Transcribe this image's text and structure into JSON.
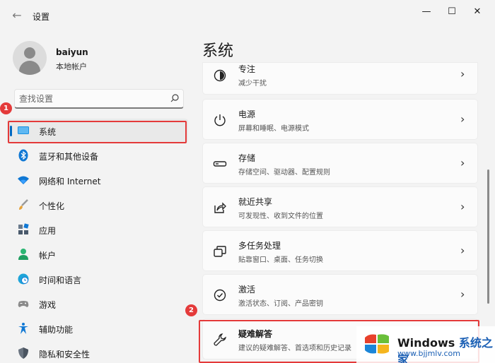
{
  "window": {
    "app_title": "设置",
    "back_glyph": "←",
    "minimize_glyph": "—",
    "maximize_glyph": "☐",
    "close_glyph": "✕"
  },
  "profile": {
    "name": "baiyun",
    "account_type": "本地帐户"
  },
  "search": {
    "placeholder": "查找设置"
  },
  "sidebar": {
    "items": [
      {
        "label": "系统",
        "icon": "monitor-icon",
        "active": true
      },
      {
        "label": "蓝牙和其他设备",
        "icon": "bluetooth-icon"
      },
      {
        "label": "网络和 Internet",
        "icon": "wifi-icon"
      },
      {
        "label": "个性化",
        "icon": "brush-icon"
      },
      {
        "label": "应用",
        "icon": "apps-icon"
      },
      {
        "label": "帐户",
        "icon": "person-icon"
      },
      {
        "label": "时间和语言",
        "icon": "globe-clock-icon"
      },
      {
        "label": "游戏",
        "icon": "gamepad-icon"
      },
      {
        "label": "辅助功能",
        "icon": "accessibility-icon"
      },
      {
        "label": "隐私和安全性",
        "icon": "shield-icon"
      }
    ]
  },
  "main": {
    "title": "系统",
    "cards": [
      {
        "title": "专注",
        "subtitle": "减少干扰",
        "icon": "focus-icon"
      },
      {
        "title": "电源",
        "subtitle": "屏幕和睡眠、电源模式",
        "icon": "power-icon"
      },
      {
        "title": "存储",
        "subtitle": "存储空间、驱动器、配置规则",
        "icon": "storage-icon"
      },
      {
        "title": "就近共享",
        "subtitle": "可发现性、收到文件的位置",
        "icon": "share-icon"
      },
      {
        "title": "多任务处理",
        "subtitle": "贴靠窗口、桌面、任务切换",
        "icon": "multitask-icon"
      },
      {
        "title": "激活",
        "subtitle": "激活状态、订阅、产品密钥",
        "icon": "check-circle-icon"
      },
      {
        "title": "疑难解答",
        "subtitle": "建议的疑难解答、首选项和历史记录",
        "icon": "wrench-icon"
      }
    ],
    "chevron": "›"
  },
  "annotations": {
    "badge_1": "1",
    "badge_2": "2"
  },
  "watermark": {
    "brand": "Windows",
    "brand_cn": "系统之家",
    "url": "www.bjjmlv.com"
  },
  "colors": {
    "accent": "#0067c0",
    "annotation": "#e43a3a"
  }
}
